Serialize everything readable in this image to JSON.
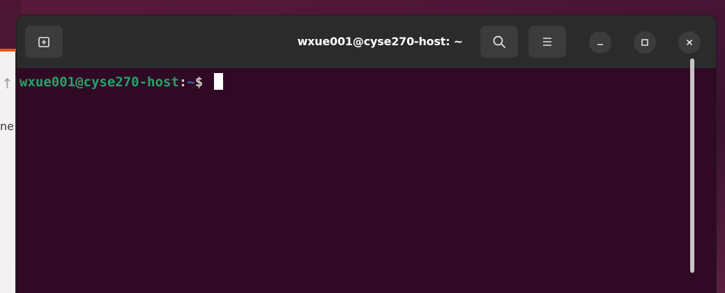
{
  "window": {
    "title": "wxue001@cyse270-host: ~"
  },
  "desktop": {
    "partial_text": "ne"
  },
  "terminal": {
    "prompt_user_host": "wxue001@cyse270-host",
    "prompt_colon": ":",
    "prompt_path": "~",
    "prompt_symbol": "$ "
  },
  "icons": {
    "new_tab": "new-tab-icon",
    "search": "search-icon",
    "menu": "hamburger-menu-icon",
    "minimize": "minimize-icon",
    "maximize": "maximize-icon",
    "close": "close-icon"
  },
  "colors": {
    "terminal_bg": "#300a24",
    "titlebar_bg": "#2b2b2b",
    "prompt_user": "#26a269",
    "prompt_path": "#3a6fc4",
    "accent": "#e95420"
  }
}
